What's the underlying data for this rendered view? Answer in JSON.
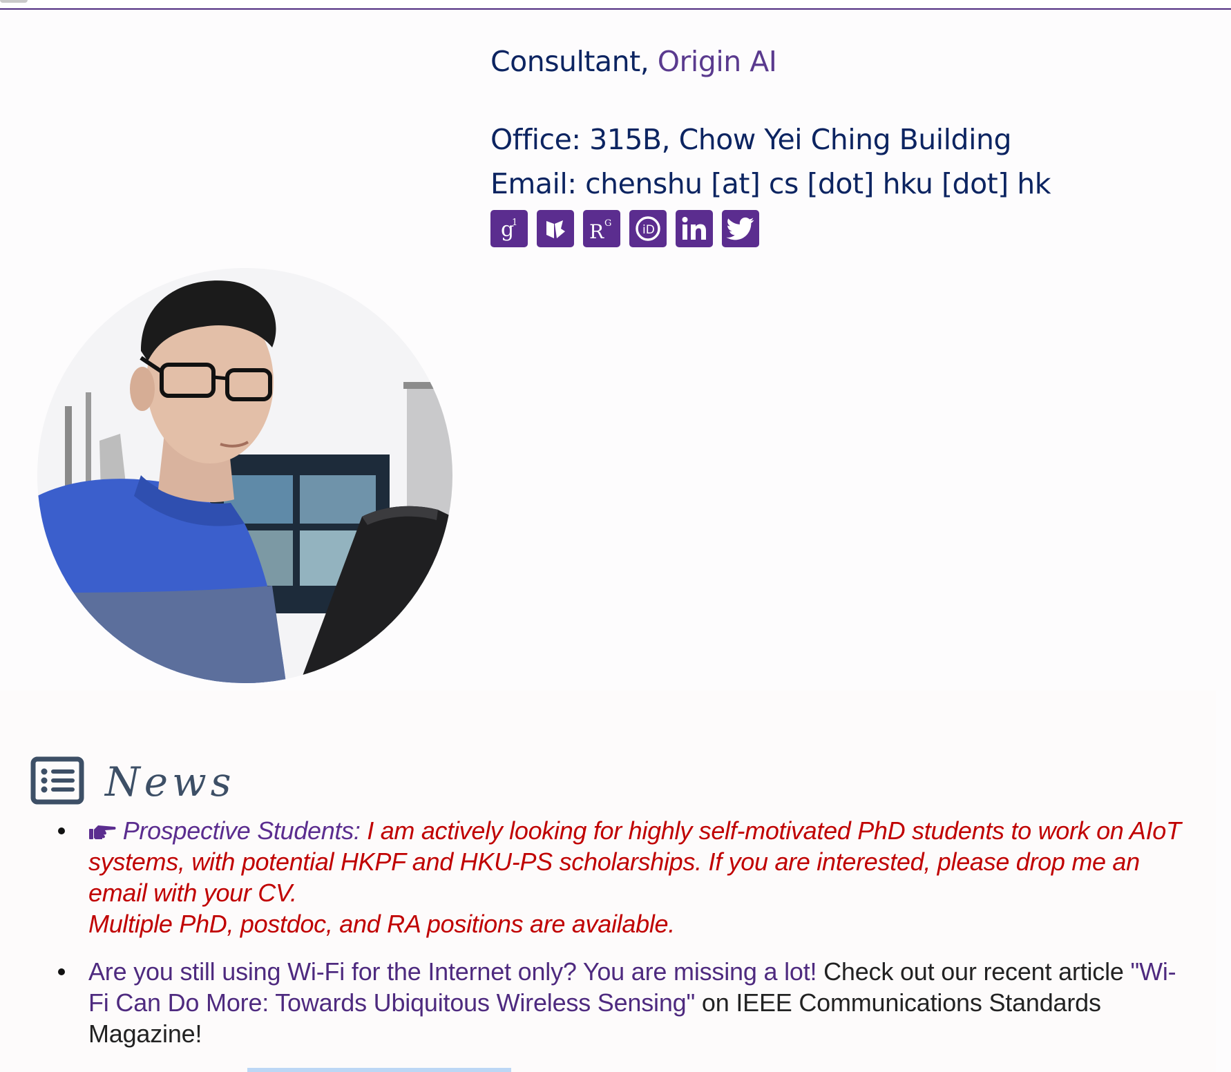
{
  "profile": {
    "role_prefix": "Consultant,",
    "organization": "Origin AI",
    "office": "Office: 315B, Chow Yei Ching Building",
    "email": "Email: chenshu [at] cs [dot] hku [dot] hk",
    "social_links": [
      "google-scholar",
      "dblp",
      "researchgate",
      "orcid",
      "linkedin",
      "twitter"
    ]
  },
  "colors": {
    "accent": "#5b2d8f",
    "heading_text": "#0c2461",
    "news_red": "#c00000",
    "link_purple": "#4e2a7f"
  },
  "news": {
    "title": "News",
    "items": {
      "prospect": {
        "label": "Prospective Students:",
        "text": " I am actively looking for highly self-motivated PhD students to work on AIoT systems, with potential HKPF and HKU-PS scholarships. If you are interested, please drop me an email with your CV.",
        "positions": "Multiple PhD, postdoc, and RA positions are available."
      },
      "wifi": {
        "lead": "Are you still using Wi-Fi for the Internet only? You are missing a lot!",
        "text1": " Check out our recent article ",
        "article": "\"Wi-Fi Can Do More: Towards Ubiquitous Wireless Sensing\"",
        "text2": " on IEEE Communications Standards Magazine!"
      }
    }
  }
}
